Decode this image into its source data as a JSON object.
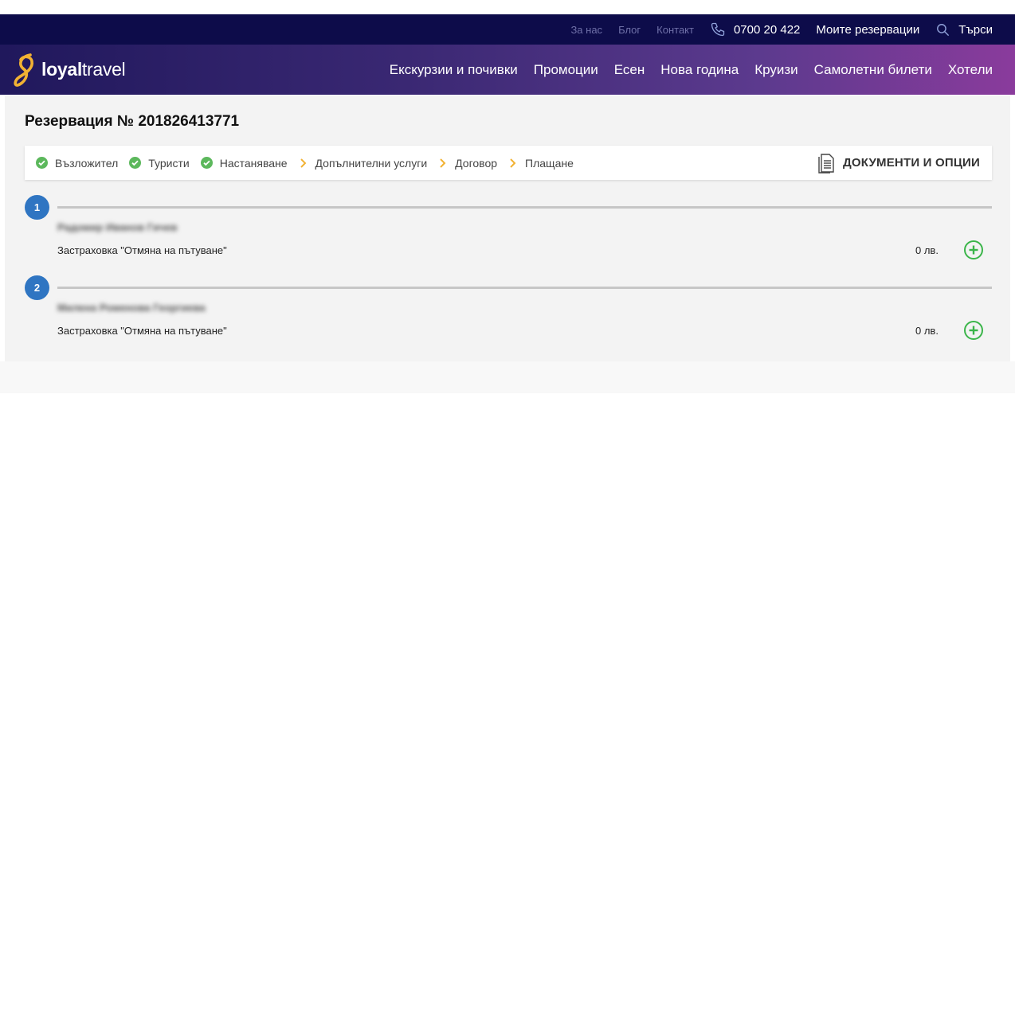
{
  "topbar": {
    "about": "За нас",
    "blog": "Блог",
    "contact": "Контакт",
    "phone": "0700 20 422",
    "my_reservations": "Моите резервации",
    "search": "Търси"
  },
  "brand": {
    "name_bold": "loyal",
    "name_light": "travel"
  },
  "nav": [
    "Екскурзии и почивки",
    "Промоции",
    "Есен",
    "Нова година",
    "Круизи",
    "Самолетни билети",
    "Хотели"
  ],
  "reservation": {
    "title": "Резервация № 201826413771"
  },
  "steps": [
    {
      "label": "Възложител",
      "status": "done"
    },
    {
      "label": "Туристи",
      "status": "done"
    },
    {
      "label": "Настаняване",
      "status": "done"
    },
    {
      "label": "Допълнителни услуги",
      "status": "next"
    },
    {
      "label": "Договор",
      "status": "next"
    },
    {
      "label": "Плащане",
      "status": "next"
    }
  ],
  "documents_label": "ДОКУМЕНТИ И ОПЦИИ",
  "tourists": [
    {
      "number": "1",
      "name": "Радомир Иванов Гичев",
      "insurance_label": "Застраховка \"Отмяна на пътуване\"",
      "price": "0 лв."
    },
    {
      "number": "2",
      "name": "Милена Роменова Георгиева",
      "insurance_label": "Застраховка \"Отмяна на пътуване\"",
      "price": "0 лв."
    }
  ],
  "colors": {
    "topbar_bg": "#0d0c4a",
    "accent_gold": "#f2b233",
    "check_green": "#5cb85c",
    "badge_blue": "#2f75c2",
    "add_green": "#3bb54a"
  }
}
